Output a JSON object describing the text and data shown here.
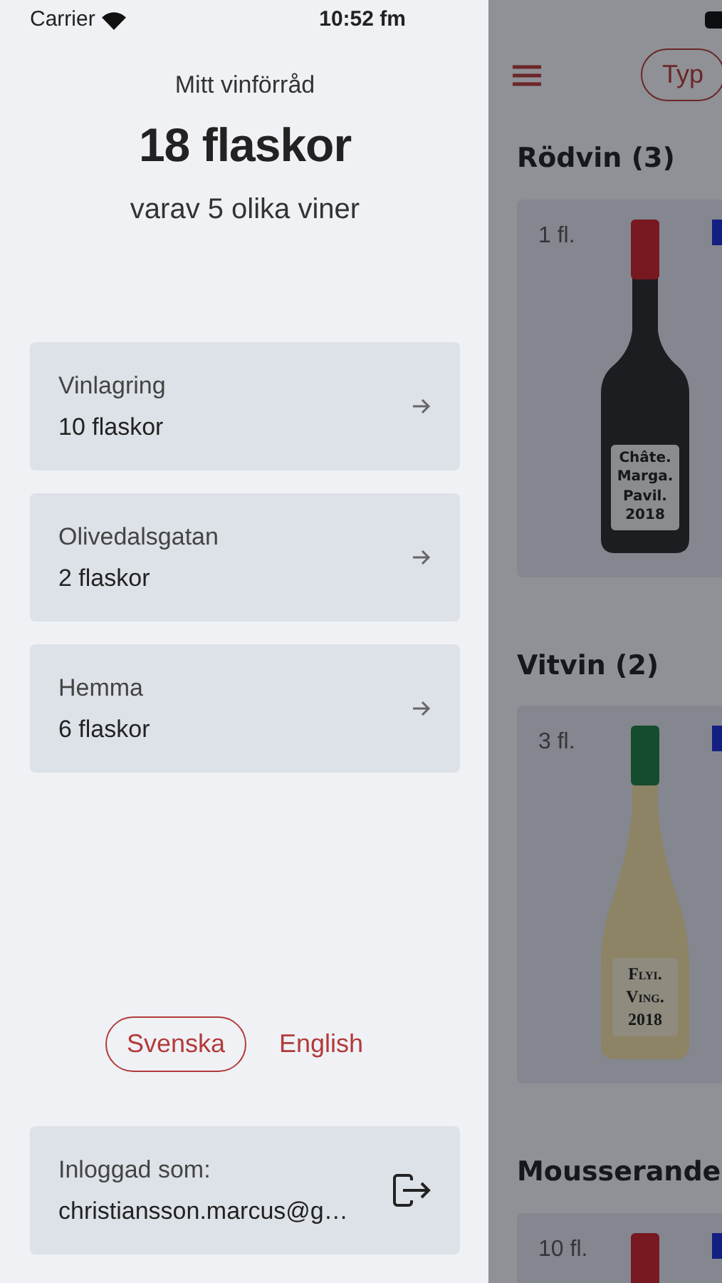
{
  "status_bar": {
    "carrier": "Carrier",
    "time": "10:52 fm"
  },
  "drawer": {
    "subtitle": "Mitt vinförråd",
    "total": "18 flaskor",
    "summary": "varav 5 olika viner",
    "locations": [
      {
        "name": "Vinlagring",
        "count": "10 flaskor"
      },
      {
        "name": "Olivedalsgatan",
        "count": "2 flaskor"
      },
      {
        "name": "Hemma",
        "count": "6 flaskor"
      }
    ],
    "languages": [
      {
        "label": "Svenska",
        "selected": true
      },
      {
        "label": "English",
        "selected": false
      }
    ],
    "account": {
      "label": "Inloggad som:",
      "email": "christiansson.marcus@g…"
    }
  },
  "main": {
    "filter_button": "Typ",
    "sections": [
      {
        "title": "Rödvin (3)",
        "wines": [
          {
            "count": "1 fl.",
            "kind": "red",
            "label": [
              "Châte.",
              "Marga.",
              "Pavil.",
              "2018"
            ]
          }
        ]
      },
      {
        "title": "Vitvin (2)",
        "wines": [
          {
            "count": "3 fl.",
            "kind": "white",
            "label": [
              "Flyi.",
              "Ving.",
              "2018"
            ]
          }
        ]
      },
      {
        "title": "Mousserande",
        "wines": [
          {
            "count": "10 fl.",
            "kind": "red"
          }
        ]
      }
    ]
  }
}
